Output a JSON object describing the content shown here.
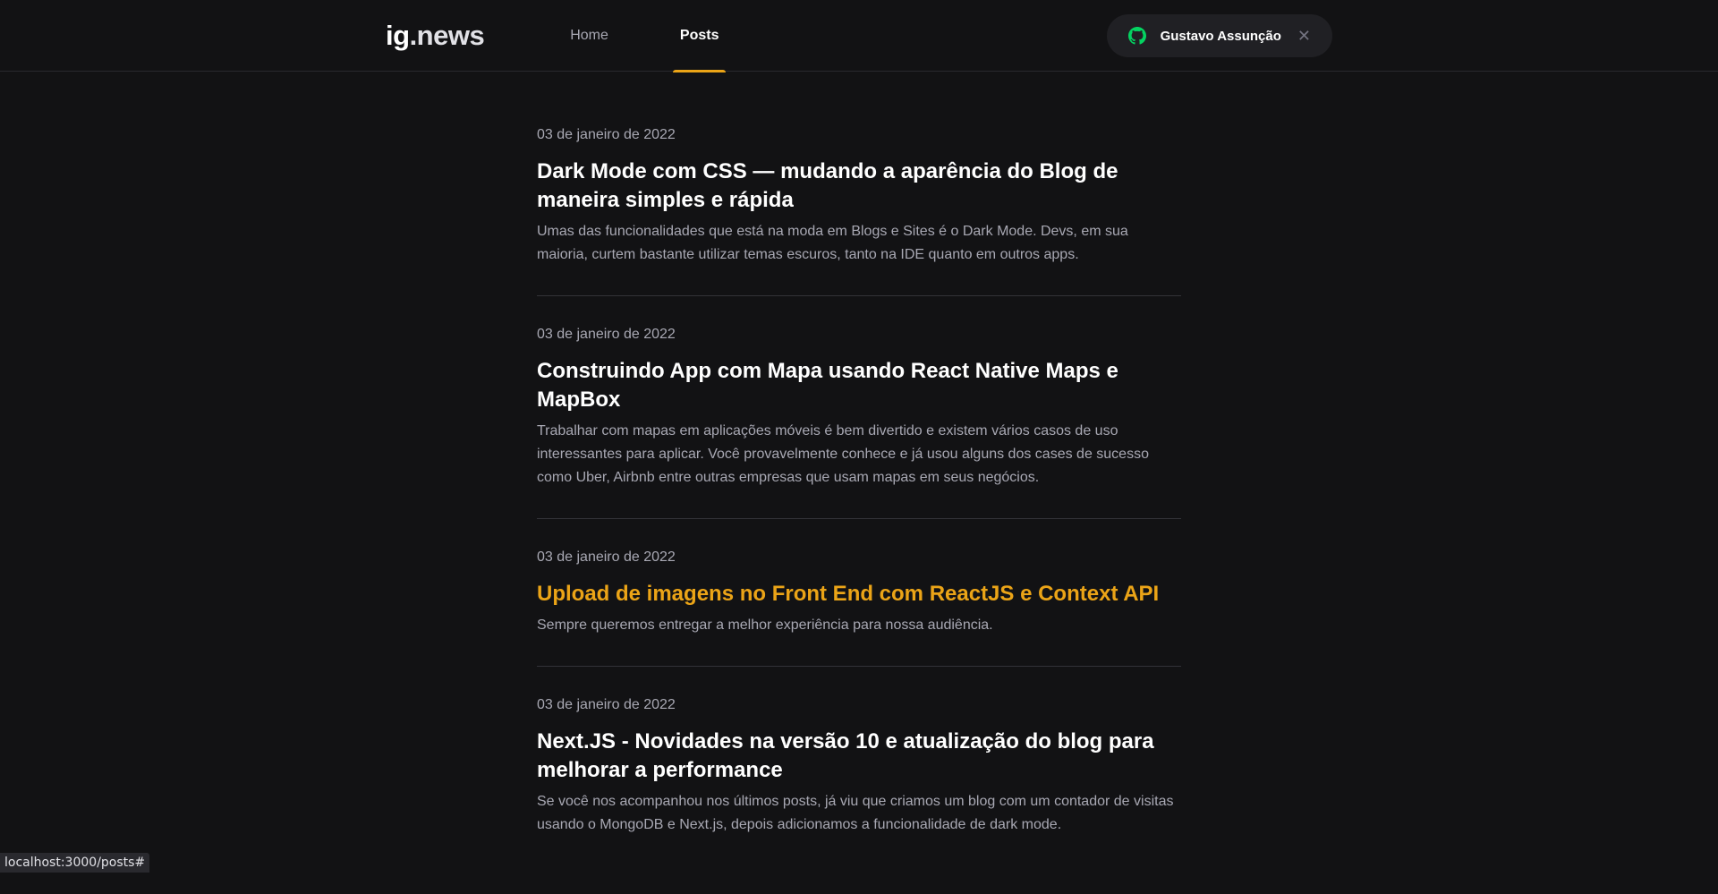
{
  "header": {
    "logo": {
      "text": "ig",
      "suffix": ".news"
    },
    "nav": [
      {
        "label": "Home",
        "active": false
      },
      {
        "label": "Posts",
        "active": true
      }
    ],
    "signin": {
      "user": "Gustavo Assunção",
      "icon": "github-icon",
      "close_icon": "close-icon"
    }
  },
  "posts": [
    {
      "date": "03 de janeiro de 2022",
      "title": "Dark Mode com CSS — mudando a aparência do Blog de maneira simples e rápida",
      "excerpt": "Umas das funcionalidades que está na moda em Blogs e Sites é o Dark Mode. Devs, em sua maioria, curtem bastante utilizar temas escuros, tanto na IDE quanto em outros apps."
    },
    {
      "date": "03 de janeiro de 2022",
      "title": "Construindo App com Mapa usando React Native Maps e MapBox",
      "excerpt": "Trabalhar com mapas em aplicações móveis é bem divertido e existem vários casos de uso interessantes para aplicar. Você provavelmente conhece e já usou alguns dos cases de sucesso como Uber, Airbnb entre outras empresas que usam mapas em seus negócios."
    },
    {
      "date": "03 de janeiro de 2022",
      "title": "Upload de imagens no Front End com ReactJS e Context API",
      "excerpt": "Sempre queremos entregar a melhor experiência para nossa audiência.",
      "hovered": true
    },
    {
      "date": "03 de janeiro de 2022",
      "title": "Next.JS - Novidades na versão 10 e atualização do blog para melhorar a performance",
      "excerpt": "Se você nos acompanhou nos últimos posts, já viu que criamos um blog com um contador de visitas usando o MongoDB e Next.js, depois adicionamos a funcionalidade de dark mode."
    }
  ],
  "statusbar": {
    "url": "localhost:3000/posts#"
  },
  "colors": {
    "accent": "#eba417",
    "background": "#121214",
    "github": "#04d361"
  }
}
